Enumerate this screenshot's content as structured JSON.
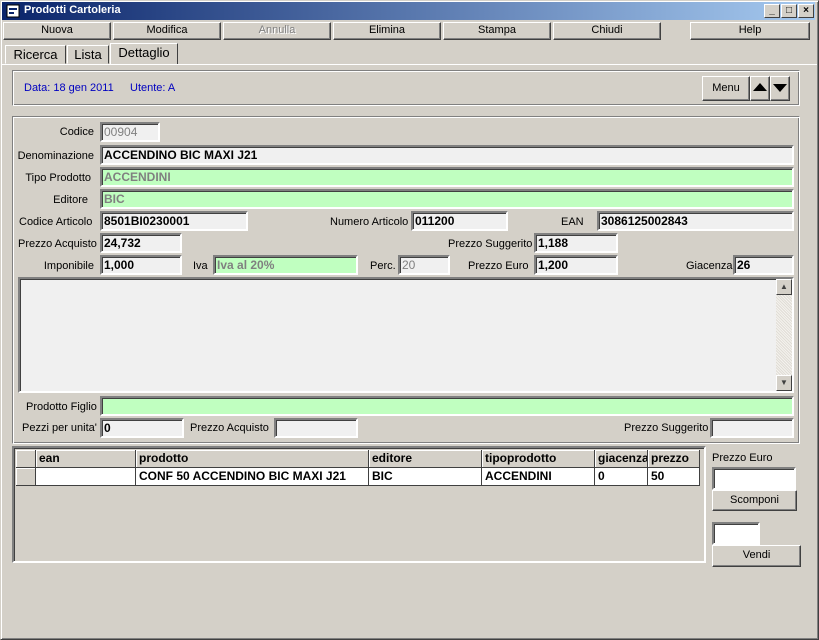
{
  "window": {
    "title": "Prodotti Cartoleria",
    "min_label": "_",
    "max_label": "□",
    "close_label": "×"
  },
  "toolbar": {
    "nuova": "Nuova",
    "modifica": "Modifica",
    "annulla": "Annulla",
    "elimina": "Elimina",
    "stampa": "Stampa",
    "chiudi": "Chiudi",
    "help": "Help"
  },
  "tabs": [
    {
      "label": "Ricerca"
    },
    {
      "label": "Lista"
    },
    {
      "label": "Dettaglio",
      "active": true
    }
  ],
  "header": {
    "date": "Data: 18 gen 2011",
    "user": "Utente: A",
    "menu_label": "Menu",
    "up_icon": "triangle-up-icon",
    "down_icon": "triangle-down-icon"
  },
  "form": {
    "codice": {
      "label": "Codice",
      "value": "00904"
    },
    "denominazione": {
      "label": "Denominazione",
      "value": "ACCENDINO BIC MAXI J21"
    },
    "tipo_prodotto": {
      "label": "Tipo Prodotto",
      "value": "ACCENDINI"
    },
    "editore": {
      "label": "Editore",
      "value": "BIC"
    },
    "codice_articolo": {
      "label": "Codice Articolo",
      "value": "8501BI0230001"
    },
    "numero_articolo": {
      "label": "Numero Articolo",
      "value": "011200"
    },
    "ean": {
      "label": "EAN",
      "value": "3086125002843"
    },
    "prezzo_acquisto": {
      "label": "Prezzo Acquisto",
      "value": "24,732"
    },
    "prezzo_suggerito": {
      "label": "Prezzo Suggerito",
      "value": "1,188"
    },
    "imponibile": {
      "label": "Imponibile",
      "value": "1,000"
    },
    "iva": {
      "label": "Iva",
      "value": "Iva al 20%"
    },
    "perc": {
      "label": "Perc.",
      "value": "20"
    },
    "prezzo_euro": {
      "label": "Prezzo Euro",
      "value": "1,200"
    },
    "giacenza": {
      "label": "Giacenza",
      "value": "26"
    },
    "note": "",
    "prodotto_figlio": {
      "label": "Prodotto Figlio",
      "value": ""
    },
    "pezzi_per_unita": {
      "label": "Pezzi per unita'",
      "value": "0"
    },
    "figlio_prezzo_acquisto": {
      "label": "Prezzo Acquisto",
      "value": ""
    },
    "figlio_prezzo_suggerito": {
      "label": "Prezzo Suggerito",
      "value": ""
    }
  },
  "grid": {
    "columns": [
      "ean",
      "prodotto",
      "editore",
      "tipoprodotto",
      "giacenza",
      "prezzo"
    ],
    "rows": [
      [
        "",
        "CONF 50 ACCENDINO BIC MAXI J21",
        "BIC",
        "ACCENDINI",
        "0",
        "50"
      ]
    ]
  },
  "side": {
    "prezzo_euro_label": "Prezzo Euro",
    "prezzo_euro_value": "",
    "scomponi": "Scomponi",
    "vendi_value": "",
    "vendi": "Vendi"
  },
  "colors": {
    "titlebar_start": "#0a246a",
    "titlebar_end": "#a6caf0",
    "green_field": "#c0ffc0",
    "header_text": "#0000c0",
    "face": "#d4d0c8"
  }
}
